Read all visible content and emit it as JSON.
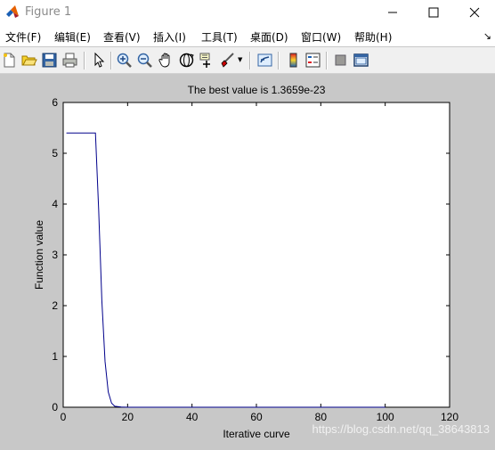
{
  "window": {
    "title": "Figure 1"
  },
  "menu": [
    "文件(F)",
    "编辑(E)",
    "查看(V)",
    "插入(I)",
    "工具(T)",
    "桌面(D)",
    "窗口(W)",
    "帮助(H)"
  ],
  "toolbar_icons": [
    "new-file-icon",
    "open-folder-icon",
    "save-icon",
    "print-icon",
    "pointer-icon",
    "zoom-in-icon",
    "zoom-out-icon",
    "pan-hand-icon",
    "rotate-3d-icon",
    "data-cursor-icon",
    "brush-icon",
    "link-plot-icon",
    "colorbar-icon",
    "legend-icon",
    "hide-plot-tools-icon",
    "show-plot-tools-icon"
  ],
  "chart_data": {
    "type": "line",
    "title": "The best value is 1.3659e-23",
    "xlabel": "Iterative curve",
    "ylabel": "Function value",
    "xlim": [
      0,
      120
    ],
    "ylim": [
      0,
      6
    ],
    "xticks": [
      "0",
      "20",
      "40",
      "60",
      "80",
      "100",
      "120"
    ],
    "yticks": [
      "0",
      "1",
      "2",
      "3",
      "4",
      "5",
      "6"
    ],
    "grid": false,
    "series": [
      {
        "color": "#00008b",
        "x": [
          1,
          10,
          11,
          12,
          13,
          14,
          15,
          16,
          18,
          20,
          40,
          60,
          80,
          100
        ],
        "y": [
          5.4,
          5.4,
          3.9,
          2.1,
          0.9,
          0.3,
          0.08,
          0.02,
          0.003,
          0.0005,
          0,
          0,
          0,
          0
        ]
      }
    ]
  },
  "watermark": "https://blog.csdn.net/qq_38643813"
}
